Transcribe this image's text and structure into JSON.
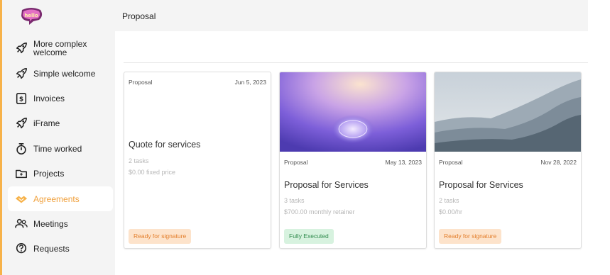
{
  "header": {
    "title": "Proposal"
  },
  "sidebar": {
    "items": [
      {
        "label": "More complex welcome",
        "icon": "rocket-icon"
      },
      {
        "label": "Simple welcome",
        "icon": "rocket-icon"
      },
      {
        "label": "Invoices",
        "icon": "invoice-icon"
      },
      {
        "label": "iFrame",
        "icon": "rocket-icon"
      },
      {
        "label": "Time worked",
        "icon": "stopwatch-icon"
      },
      {
        "label": "Projects",
        "icon": "folder-icon"
      },
      {
        "label": "Agreements",
        "icon": "handshake-icon"
      },
      {
        "label": "Meetings",
        "icon": "people-icon"
      },
      {
        "label": "Requests",
        "icon": "question-icon"
      }
    ],
    "active_index": 6
  },
  "cards": [
    {
      "type": "Proposal",
      "date": "Jun 5, 2023",
      "title": "Quote for services",
      "tasks": "2 tasks",
      "price": "$0.00 fixed price",
      "status": "Ready for signature",
      "status_color": "orange",
      "image": "none"
    },
    {
      "type": "Proposal",
      "date": "May 13, 2023",
      "title": "Proposal for Services",
      "tasks": "3 tasks",
      "price": "$700.00 monthly retainer",
      "status": "Fully Executed",
      "status_color": "green",
      "image": "brain"
    },
    {
      "type": "Proposal",
      "date": "Nov 28, 2022",
      "title": "Proposal for Services",
      "tasks": "2 tasks",
      "price": "$0.00/hr",
      "status": "Ready for signature",
      "status_color": "orange",
      "image": "mountains"
    }
  ],
  "colors": {
    "accent": "#f0a03c",
    "sidebar_bg": "#f4f4f4",
    "badge_orange_bg": "#fde3cb",
    "badge_green_bg": "#d7f2df"
  }
}
